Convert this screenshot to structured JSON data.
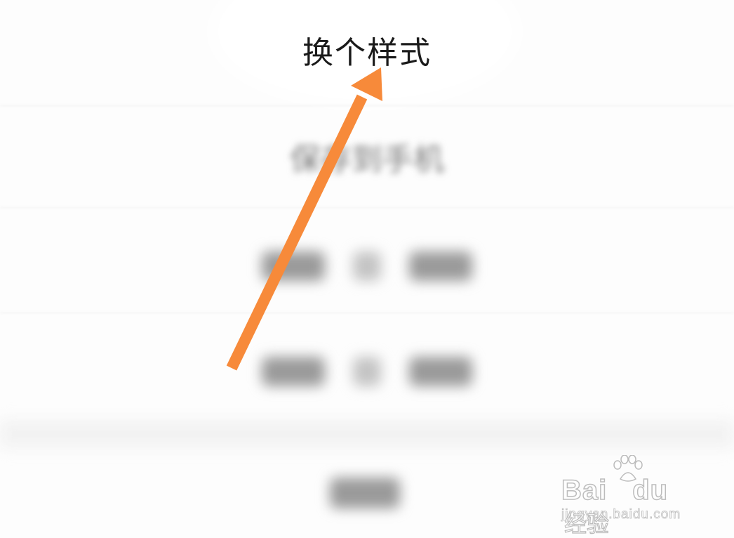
{
  "menu": {
    "change_style_label": "换个样式",
    "save_to_phone_label": "保存到手机"
  },
  "watermark": {
    "brand_latin_1": "Bai",
    "brand_latin_2": "du",
    "brand_chinese": "经验",
    "url": "jingyan.baidu.com"
  },
  "annotation": {
    "arrow_color": "#F78A3A",
    "arrow_icon": "arrow-up-right-icon"
  },
  "colors": {
    "background": "#FDFDFD",
    "divider": "#EDEDED"
  }
}
